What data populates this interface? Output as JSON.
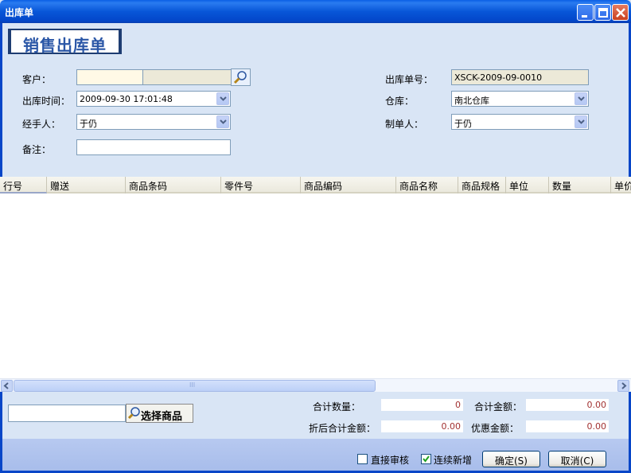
{
  "window": {
    "title": "出库单"
  },
  "banner": {
    "title": "销售出库单"
  },
  "form": {
    "customer_label": "客户：",
    "customer_value": "",
    "time_label": "出库时间：",
    "time_value": "2009-09-30 17:01:48",
    "handler_label": "经手人：",
    "handler_value": "于仍",
    "remark_label": "备注：",
    "remark_value": "",
    "order_no_label": "出库单号：",
    "order_no_value": "XSCK-2009-09-0010",
    "warehouse_label": "仓库：",
    "warehouse_value": "南北仓库",
    "maker_label": "制单人：",
    "maker_value": "于仍"
  },
  "grid": {
    "columns": [
      "行号",
      "赠送",
      "商品条码",
      "零件号",
      "商品编码",
      "商品名称",
      "商品规格",
      "单位",
      "数量",
      "单价"
    ],
    "rows": []
  },
  "scrollbar": {
    "thumb_grip": "III"
  },
  "picker": {
    "button_label": "选择商品",
    "input_value": ""
  },
  "summary": {
    "total_qty_label": "合计数量：",
    "total_qty_value": "0",
    "total_amount_label": "合计金额：",
    "total_amount_value": "0.00",
    "discount_total_label": "折后合计金额：",
    "discount_total_value": "0.00",
    "promo_label": "优惠金额：",
    "promo_value": "0.00"
  },
  "footer": {
    "direct_audit_label": "直接审核",
    "direct_audit_checked": false,
    "continuous_add_label": "连续新增",
    "continuous_add_checked": true,
    "ok_label": "确定(S)",
    "cancel_label": "取消(C)"
  },
  "colors": {
    "title_blue": "#0a5fe6",
    "body_bg": "#d9e5f5",
    "amount_red": "#a23232",
    "banner_text": "#2a56a6"
  },
  "icons": [
    "minimize-icon",
    "maximize-icon",
    "close-icon",
    "magnifier-icon",
    "chevron-down-icon",
    "arrow-left-icon",
    "arrow-right-icon",
    "checkmark-icon"
  ]
}
